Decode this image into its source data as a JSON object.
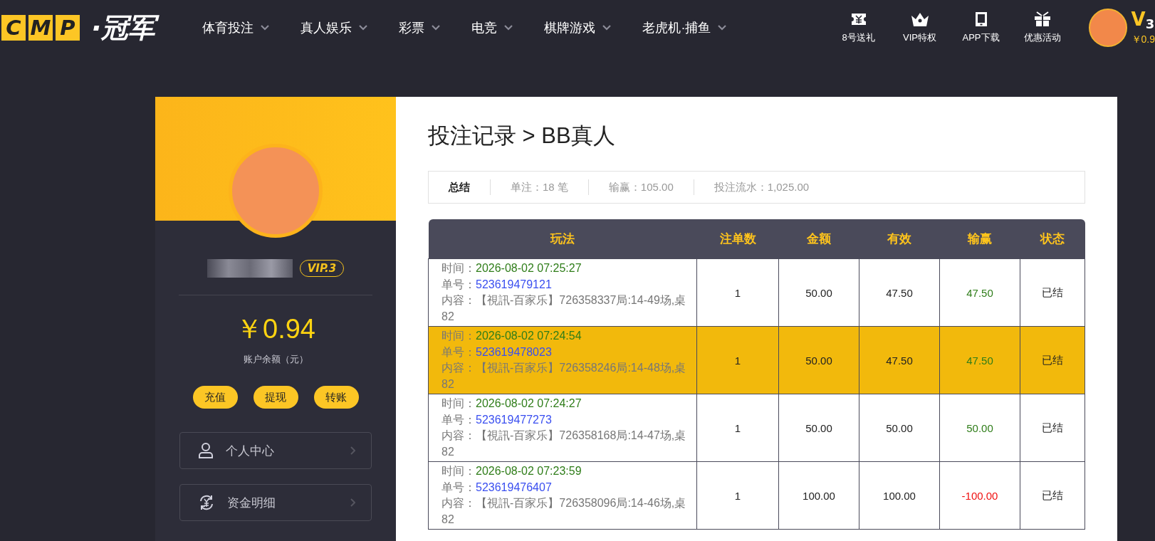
{
  "header": {
    "logo_letters": [
      "C",
      "M",
      "P"
    ],
    "logo_text": "·冠军",
    "nav": [
      {
        "label": "体育投注"
      },
      {
        "label": "真人娱乐"
      },
      {
        "label": "彩票"
      },
      {
        "label": "电竞"
      },
      {
        "label": "棋牌游戏"
      },
      {
        "label": "老虎机·捕鱼"
      }
    ],
    "quick_links": [
      {
        "kind": "ticket",
        "label": "8号送礼"
      },
      {
        "kind": "crown",
        "label": "VIP特权"
      },
      {
        "kind": "tablet",
        "label": "APP下载"
      },
      {
        "kind": "gift",
        "label": "优惠活动"
      }
    ],
    "vip_level": "V$_{3}$",
    "balance": "￥0.9"
  },
  "profile": {
    "vip_badge": "VIP.3",
    "balance": "￥0.94",
    "balance_label": "账户余额（元）",
    "actions": [
      "充值",
      "提现",
      "转账"
    ],
    "menu": [
      {
        "kind": "user",
        "label": "个人中心"
      },
      {
        "kind": "funds",
        "label": "资金明细"
      }
    ]
  },
  "records": {
    "title": "投注记录 > BB真人",
    "summary": {
      "label": "总结",
      "items": [
        "单注：18 笔",
        "输赢：105.00",
        "投注流水：1,025.00"
      ]
    },
    "table": {
      "columns": [
        "玩法",
        "注单数",
        "金额",
        "有效",
        "输赢",
        "状态"
      ],
      "rows": [
        {
          "selected": false,
          "time_label": "时间：",
          "time": "2026-08-02 07:25:27",
          "order_label": "单号：",
          "order_no": "523619479121",
          "content_label": "内容：",
          "content": "【視訊-百家乐】726358337局:14-49场,桌82",
          "count": "1",
          "amount": "50.00",
          "valid": "47.50",
          "kind": "win",
          "win_loss": "47.50",
          "status": "已结"
        },
        {
          "selected": true,
          "time_label": "时间：",
          "time": "2026-08-02 07:24:54",
          "order_label": "单号：",
          "order_no": "523619478023",
          "content_label": "内容：",
          "content": "【視訊-百家乐】726358246局:14-48场,桌82",
          "count": "1",
          "amount": "50.00",
          "valid": "47.50",
          "kind": "win",
          "win_loss": "47.50",
          "status": "已结"
        },
        {
          "selected": false,
          "time_label": "时间：",
          "time": "2026-08-02 07:24:27",
          "order_label": "单号：",
          "order_no": "523619477273",
          "content_label": "内容：",
          "content": "【視訊-百家乐】726358168局:14-47场,桌82",
          "count": "1",
          "amount": "50.00",
          "valid": "50.00",
          "kind": "win",
          "win_loss": "50.00",
          "status": "已结"
        },
        {
          "selected": false,
          "time_label": "时间：",
          "time": "2026-08-02 07:23:59",
          "order_label": "单号：",
          "order_no": "523619476407",
          "content_label": "内容：",
          "content": "【視訊-百家乐】726358096局:14-46场,桌82",
          "count": "1",
          "amount": "100.00",
          "valid": "100.00",
          "kind": "loss",
          "win_loss": "-100.00",
          "status": "已结"
        }
      ]
    }
  }
}
